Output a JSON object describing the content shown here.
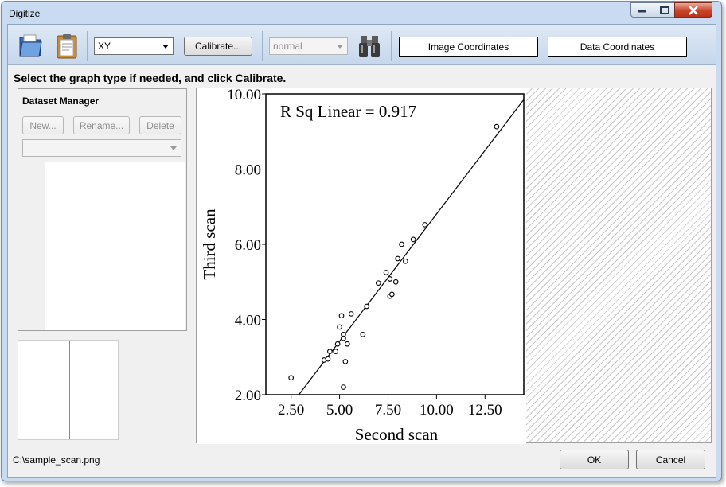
{
  "window": {
    "title": "Digitize"
  },
  "toolbar": {
    "graph_type": "XY",
    "calibrate_label": "Calibrate...",
    "mode": "normal",
    "image_coords_label": "Image Coordinates",
    "data_coords_label": "Data Coordinates"
  },
  "instruction": "Select the graph type if needed, and click Calibrate.",
  "dataset_manager": {
    "title": "Dataset Manager",
    "new_label": "New...",
    "rename_label": "Rename...",
    "delete_label": "Delete"
  },
  "status": {
    "filename": "C:\\sample_scan.png"
  },
  "buttons": {
    "ok": "OK",
    "cancel": "Cancel"
  },
  "chart_data": {
    "type": "scatter",
    "annotation": "R Sq Linear = 0.917",
    "xlabel": "Second scan",
    "ylabel": "Third scan",
    "xlim": [
      1.2,
      14.5
    ],
    "ylim": [
      2.0,
      10.0
    ],
    "x_ticks": [
      "2.50",
      "5.00",
      "7.50",
      "10.00",
      "12.50"
    ],
    "y_ticks": [
      "2.00",
      "4.00",
      "6.00",
      "8.00",
      "10.00"
    ],
    "x_tick_values": [
      2.5,
      5.0,
      7.5,
      10.0,
      12.5
    ],
    "y_tick_values": [
      2.0,
      4.0,
      6.0,
      8.0,
      10.0
    ],
    "points": [
      [
        2.5,
        2.45
      ],
      [
        4.2,
        2.92
      ],
      [
        4.4,
        2.95
      ],
      [
        4.5,
        3.15
      ],
      [
        4.8,
        3.15
      ],
      [
        4.9,
        3.35
      ],
      [
        5.0,
        3.8
      ],
      [
        5.1,
        4.1
      ],
      [
        5.2,
        3.6
      ],
      [
        5.2,
        3.5
      ],
      [
        5.3,
        2.88
      ],
      [
        5.2,
        2.2
      ],
      [
        5.4,
        3.35
      ],
      [
        5.6,
        4.15
      ],
      [
        6.2,
        3.6
      ],
      [
        6.4,
        4.35
      ],
      [
        7.0,
        4.97
      ],
      [
        7.4,
        5.25
      ],
      [
        7.6,
        5.08
      ],
      [
        7.6,
        4.62
      ],
      [
        7.7,
        4.67
      ],
      [
        7.9,
        5.0
      ],
      [
        8.0,
        5.62
      ],
      [
        8.2,
        6.0
      ],
      [
        8.4,
        5.55
      ],
      [
        8.8,
        6.13
      ],
      [
        9.4,
        6.52
      ],
      [
        13.1,
        9.13
      ]
    ],
    "fit_line": [
      [
        2.9,
        2.0
      ],
      [
        14.5,
        9.85
      ]
    ]
  }
}
